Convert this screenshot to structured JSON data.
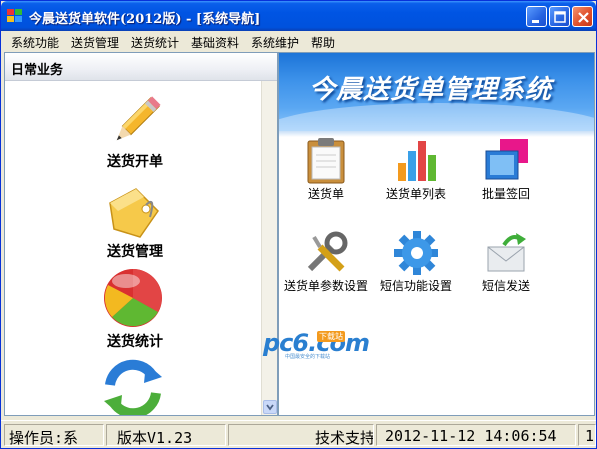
{
  "window": {
    "title": "今晨送货单软件(2012版) - [系统导航]"
  },
  "menu": [
    {
      "label": "系统功能"
    },
    {
      "label": "送货管理"
    },
    {
      "label": "送货统计"
    },
    {
      "label": "基础资料"
    },
    {
      "label": "系统维护"
    },
    {
      "label": "帮助"
    }
  ],
  "left_panel": {
    "header": "日常业务",
    "items": [
      {
        "label": "送货开单",
        "icon": "pencil-icon"
      },
      {
        "label": "送货管理",
        "icon": "tag-icon"
      },
      {
        "label": "送货统计",
        "icon": "pie-chart-icon"
      },
      {
        "label": "",
        "icon": "refresh-icon"
      }
    ]
  },
  "right_panel": {
    "banner_title": "今晨送货单管理系统",
    "items": [
      {
        "label": "送货单",
        "icon": "clipboard-icon"
      },
      {
        "label": "送货单列表",
        "icon": "bar-chart-icon"
      },
      {
        "label": "批量签回",
        "icon": "monitor-icon"
      },
      {
        "label": "送货单参数设置",
        "icon": "tools-icon"
      },
      {
        "label": "短信功能设置",
        "icon": "gear-icon"
      },
      {
        "label": "短信发送",
        "icon": "mail-icon"
      }
    ]
  },
  "watermark": {
    "main": "pc6.com",
    "badge": "下载站",
    "sub": "中国最安全的下载站"
  },
  "status": {
    "operator": "操作员:系",
    "version": "版本V1.23",
    "support": "技术支持",
    "datetime": "2012-11-12 14:06:54",
    "extra": "1"
  },
  "colors": {
    "titlebar": "#0054e3",
    "banner": "#3d92ea",
    "window_bg": "#ece9d8"
  }
}
